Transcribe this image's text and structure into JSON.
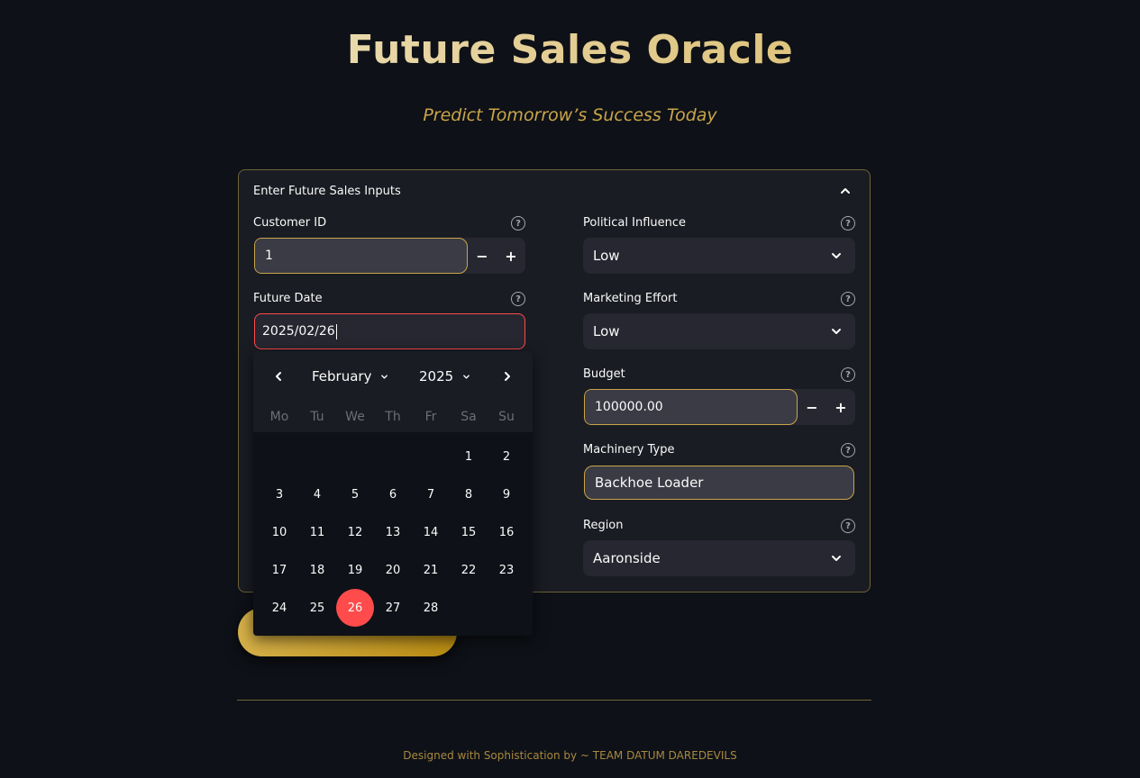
{
  "header": {
    "title": "Future Sales Oracle",
    "subtitle": "Predict Tomorrow’s Success Today"
  },
  "form": {
    "expander_label": "Enter Future Sales Inputs",
    "customer_id": {
      "label": "Customer ID",
      "value": "1"
    },
    "future_date": {
      "label": "Future Date",
      "value": "2025/02/26"
    },
    "political_influence": {
      "label": "Political Influence",
      "value": "Low"
    },
    "marketing_effort": {
      "label": "Marketing Effort",
      "value": "Low"
    },
    "budget": {
      "label": "Budget",
      "value": "100000.00"
    },
    "machinery_type": {
      "label": "Machinery Type",
      "value": "Backhoe Loader"
    },
    "region": {
      "label": "Region",
      "value": "Aaronside"
    },
    "help_symbol": "?",
    "minus_symbol": "−",
    "plus_symbol": "+"
  },
  "calendar": {
    "month": "February",
    "year": "2025",
    "weekdays": [
      "Mo",
      "Tu",
      "We",
      "Th",
      "Fr",
      "Sa",
      "Su"
    ],
    "first_weekday_index": 5,
    "days_in_month": 28,
    "selected_day": 26
  },
  "predict_button": {
    "label": ""
  },
  "footer": {
    "text": "Designed with Sophistication by ~ TEAM DATUM DAREDEVILS"
  },
  "colors": {
    "background": "#0e1117",
    "gold_accent": "#c9a54a",
    "selected_red": "#ff4b4b",
    "panel_bg": "#1a1c23",
    "input_bg": "#262730"
  },
  "icons": {
    "expander": "chevron-up-icon",
    "help": "help-circle-icon",
    "dropdown": "chevron-down-icon",
    "prev_month": "chevron-left-icon",
    "next_month": "chevron-right-icon"
  }
}
